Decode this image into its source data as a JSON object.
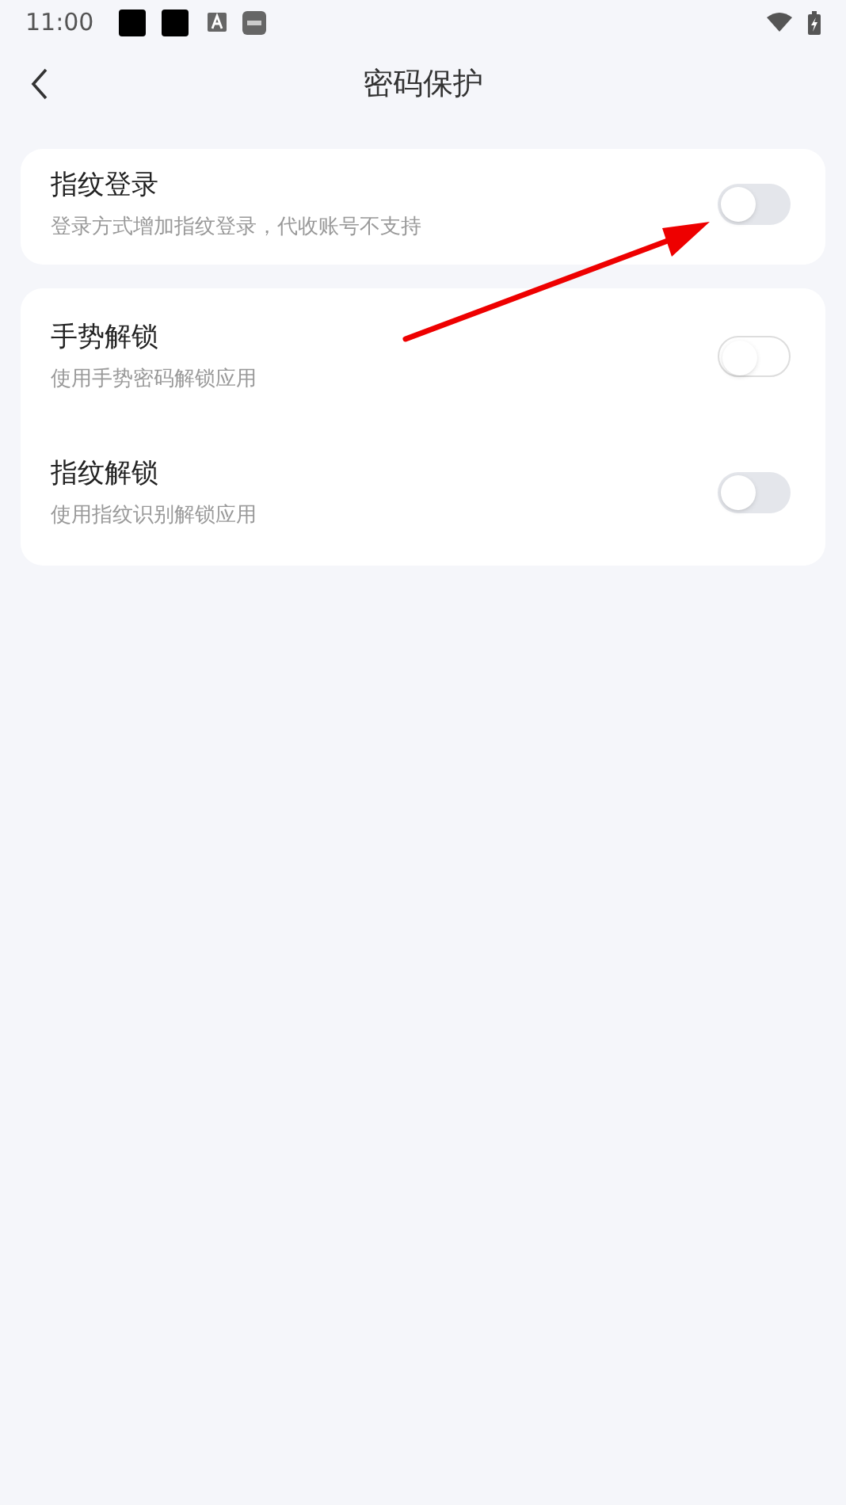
{
  "status_bar": {
    "time": "11:00"
  },
  "header": {
    "title": "密码保护"
  },
  "groups": [
    {
      "items": [
        {
          "title": "指纹登录",
          "subtitle": "登录方式增加指纹登录，代收账号不支持",
          "on": false,
          "kind": "filled"
        }
      ]
    },
    {
      "items": [
        {
          "title": "手势解锁",
          "subtitle": "使用手势密码解锁应用",
          "on": false,
          "kind": "outline"
        },
        {
          "title": "指纹解锁",
          "subtitle": "使用指纹识别解锁应用",
          "on": false,
          "kind": "filled"
        }
      ]
    }
  ]
}
